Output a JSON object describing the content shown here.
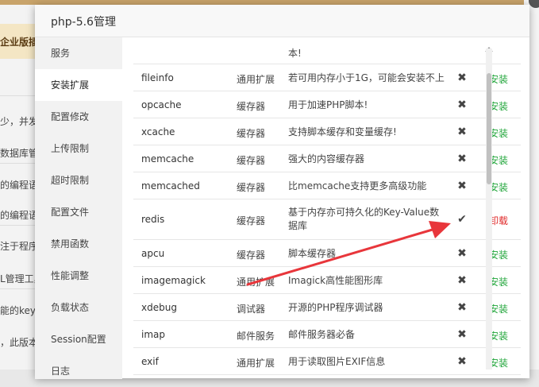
{
  "background": {
    "banner": "企业版插",
    "lines": [
      "少，并发",
      "数据库管",
      "的编程语",
      "的编程语",
      "注于程序",
      "L管理工具",
      "能的key-v",
      "，此版本"
    ]
  },
  "modal": {
    "title": "php-5.6管理"
  },
  "sidebar": {
    "items": [
      {
        "label": "服务"
      },
      {
        "label": "安装扩展"
      },
      {
        "label": "配置修改"
      },
      {
        "label": "上传限制"
      },
      {
        "label": "超时限制"
      },
      {
        "label": "配置文件"
      },
      {
        "label": "禁用函数"
      },
      {
        "label": "性能调整"
      },
      {
        "label": "负载状态"
      },
      {
        "label": "Session配置"
      },
      {
        "label": "日志"
      }
    ]
  },
  "extensions": {
    "partial_desc": "本!",
    "rows": [
      {
        "name": "fileinfo",
        "type": "通用扩展",
        "desc": "若可用内存小于1G，可能会安装不上",
        "status": "not-installed",
        "status_icon": "x-icon",
        "action": "安装"
      },
      {
        "name": "opcache",
        "type": "缓存器",
        "desc": "用于加速PHP脚本!",
        "status": "not-installed",
        "status_icon": "x-icon",
        "action": "安装"
      },
      {
        "name": "xcache",
        "type": "缓存器",
        "desc": "支持脚本缓存和变量缓存!",
        "status": "not-installed",
        "status_icon": "x-icon",
        "action": "安装"
      },
      {
        "name": "memcache",
        "type": "缓存器",
        "desc": "强大的内容缓存器",
        "status": "not-installed",
        "status_icon": "x-icon",
        "action": "安装"
      },
      {
        "name": "memcached",
        "type": "缓存器",
        "desc": "比memcache支持更多高级功能",
        "status": "not-installed",
        "status_icon": "x-icon",
        "action": "安装"
      },
      {
        "name": "redis",
        "type": "缓存器",
        "desc": "基于内存亦可持久化的Key-Value数据库",
        "status": "installed",
        "status_icon": "check-icon",
        "action": "卸载"
      },
      {
        "name": "apcu",
        "type": "缓存器",
        "desc": "脚本缓存器",
        "status": "not-installed",
        "status_icon": "x-icon",
        "action": "安装"
      },
      {
        "name": "imagemagick",
        "type": "通用扩展",
        "desc": "Imagick高性能图形库",
        "status": "not-installed",
        "status_icon": "x-icon",
        "action": "安装"
      },
      {
        "name": "xdebug",
        "type": "调试器",
        "desc": "开源的PHP程序调试器",
        "status": "not-installed",
        "status_icon": "x-icon",
        "action": "安装"
      },
      {
        "name": "imap",
        "type": "邮件服务",
        "desc": "邮件服务器必备",
        "status": "not-installed",
        "status_icon": "x-icon",
        "action": "安装"
      },
      {
        "name": "exif",
        "type": "通用扩展",
        "desc": "用于读取图片EXIF信息",
        "status": "not-installed",
        "status_icon": "x-icon",
        "action": "安装"
      }
    ]
  },
  "colors": {
    "install": "#20a53a",
    "uninstall": "#e02b2b",
    "annotation_arrow": "#e8363b"
  }
}
